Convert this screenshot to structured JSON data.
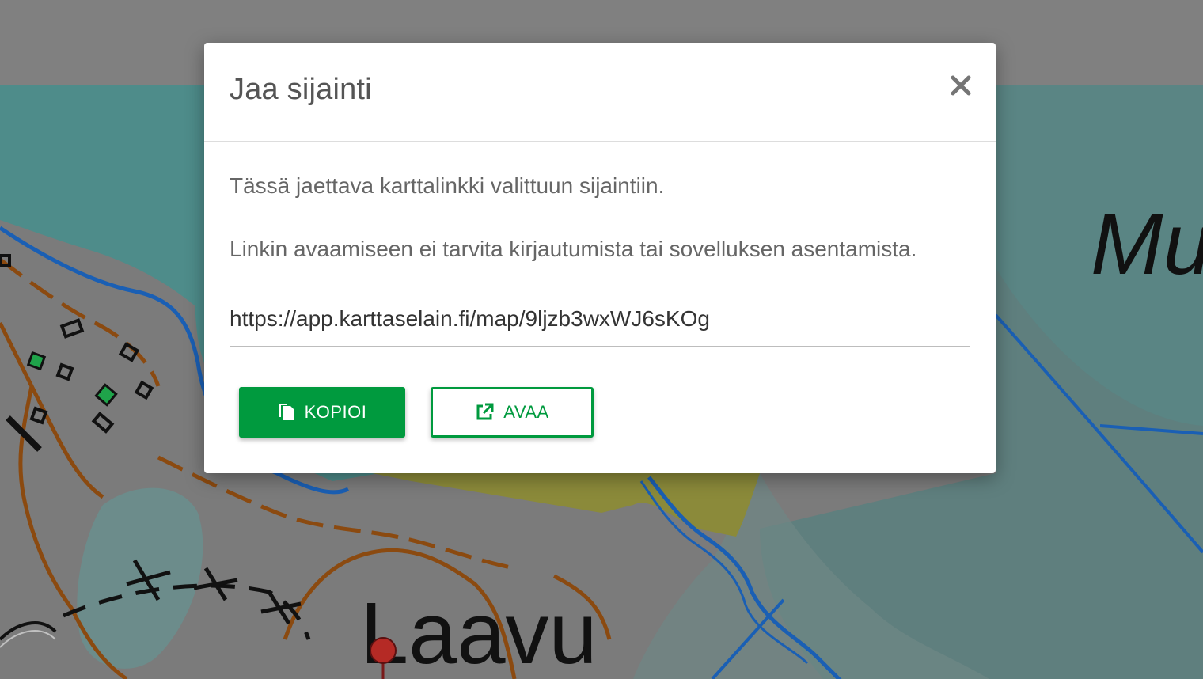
{
  "map": {
    "labels": {
      "place_1": "Laavu",
      "place_2": "Mu"
    }
  },
  "dialog": {
    "title": "Jaa sijainti",
    "close_label": "×",
    "description_1": "Tässä jaettava karttalinkki valittuun sijaintiin.",
    "description_2": "Linkin avaamiseen ei tarvita kirjautumista tai sovelluksen asentamista.",
    "share_link": "https://app.karttaselain.fi/map/9ljzb3wxWJ6sKOg",
    "copy_button": {
      "label": "KOPIOI",
      "icon": "copy-icon"
    },
    "open_button": {
      "label": "AVAA",
      "icon": "external-link-icon"
    }
  },
  "colors": {
    "accent": "#009a3e",
    "overlay": "#7e7e7e"
  }
}
